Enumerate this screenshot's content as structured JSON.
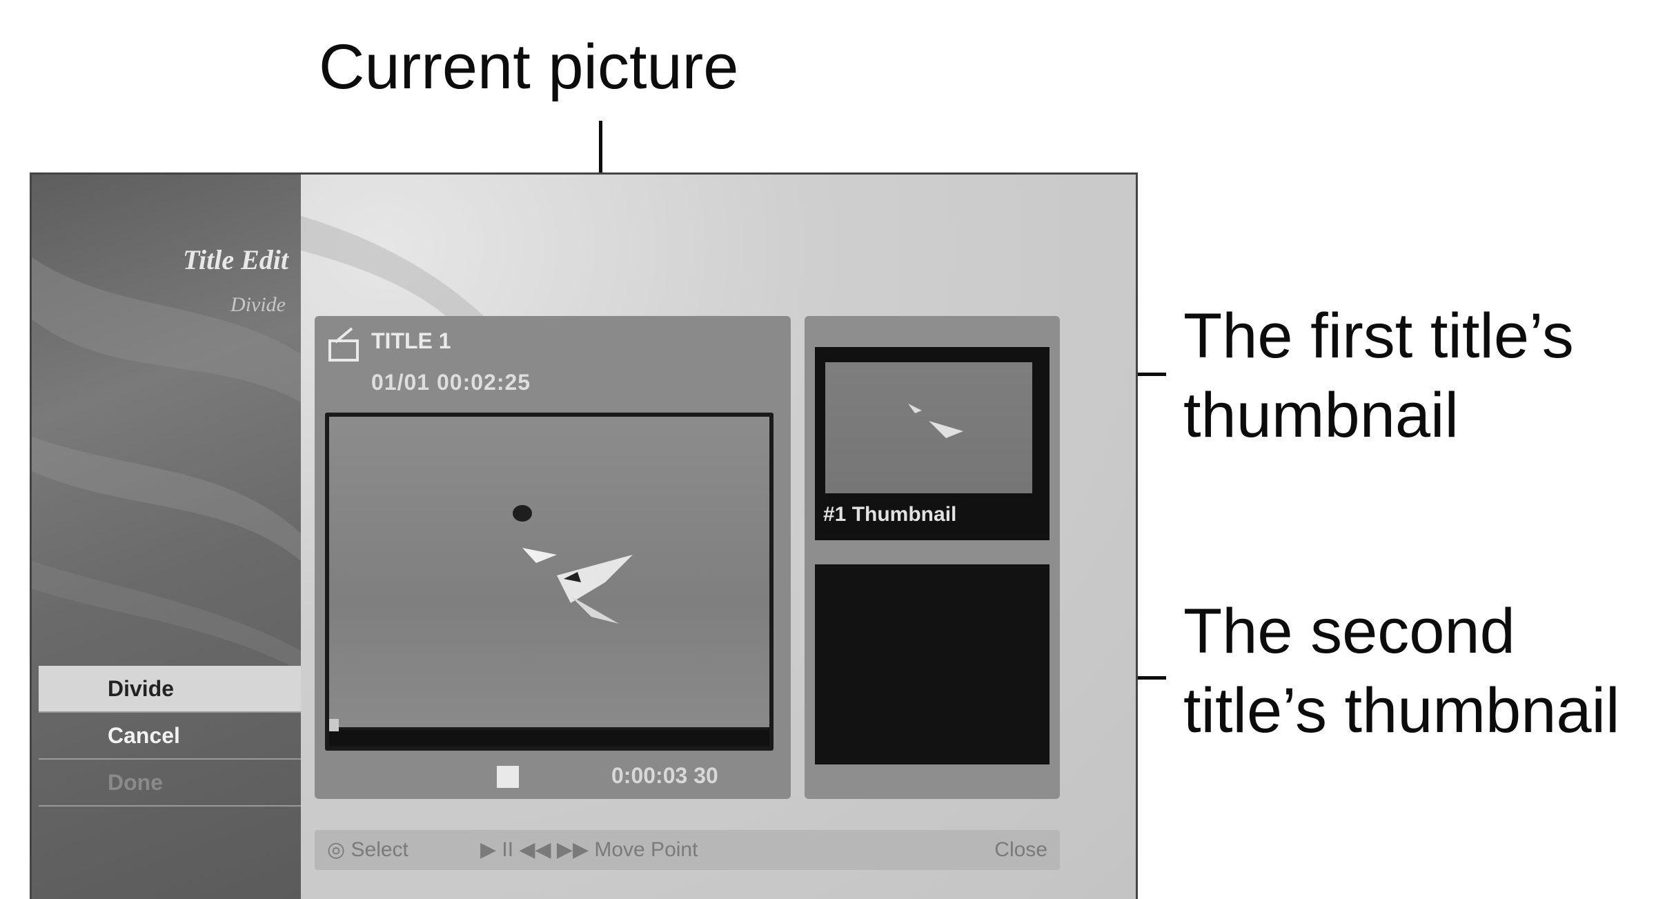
{
  "callouts": {
    "current_picture": "Current picture",
    "first_thumb_line1": "The first title’s",
    "first_thumb_line2": "thumbnail",
    "second_thumb_line1": "The second",
    "second_thumb_line2": "title’s thumbnail"
  },
  "sidebar": {
    "title": "Title Edit",
    "subtitle": "Divide",
    "menu": [
      {
        "label": "Divide",
        "state": "selected"
      },
      {
        "label": "Cancel",
        "state": "normal"
      },
      {
        "label": "Done",
        "state": "disabled"
      }
    ]
  },
  "player": {
    "title": "TITLE 1",
    "info": "01/01   00:02:25",
    "time": "0:00:03  30",
    "progress": 0.0
  },
  "thumbnails": {
    "first_label": "#1 Thumbnail"
  },
  "help_bar": {
    "select": "◎ Select",
    "move": "▶ II ◀◀ ▶▶ Move Point",
    "close": "Close"
  },
  "colors": {
    "sidebar": "#6a6a6a",
    "panel": "#8a8a8a",
    "background": "#c9c9c9"
  }
}
